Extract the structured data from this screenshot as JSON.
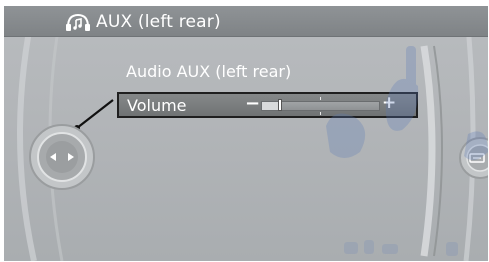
{
  "header": {
    "title": "AUX (left rear)",
    "icon": "audio-source-icon"
  },
  "main": {
    "heading": "Audio AUX (left rear)",
    "volume": {
      "label": "Volume",
      "minus_symbol": "−",
      "plus_symbol": "+",
      "level": 0.15
    }
  },
  "controls": {
    "controller_icon": "idrive-controller-icon",
    "right_icon": "options-button-icon"
  },
  "colors": {
    "panel": "#b2b5b8",
    "title_bar": "#878b8e",
    "text": "#ffffff",
    "highlight_border": "#1f1f1f",
    "watermark": "#5a79b8"
  }
}
